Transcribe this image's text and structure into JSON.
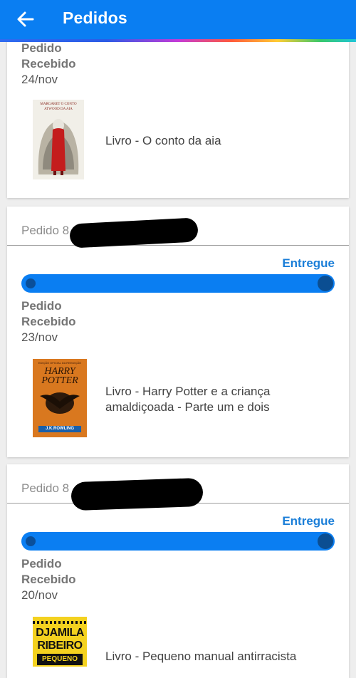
{
  "appbar": {
    "title": "Pedidos",
    "back_icon": "arrow-left-icon"
  },
  "orders": [
    {
      "stage_label_1": "Pedido",
      "stage_label_2": "Recebido",
      "date": "24/nov",
      "item": "Livro - O conto da aia",
      "cover": {
        "title": "MARGARET O CONTO",
        "subtitle": "ATWOOD DA AIA"
      }
    },
    {
      "order_label": "Pedido 8",
      "status": "Entregue",
      "progress": 1.0,
      "stage_label_1": "Pedido",
      "stage_label_2": "Recebido",
      "date": "23/nov",
      "item_line1": "Livro - Harry Potter e a criança",
      "item_line2": "amaldiçoada - Parte um e dois",
      "cover": {
        "top": "EDIÇÃO OFICIAL DA REEDIÇÃO",
        "title1": "HARRY",
        "title2": "POTTER",
        "author": "J.K.ROWLING"
      }
    },
    {
      "order_label": "Pedido 8",
      "status": "Entregue",
      "progress": 1.0,
      "stage_label_1": "Pedido",
      "stage_label_2": "Recebido",
      "date": "20/nov",
      "item": "Livro - Pequeno manual antirracista",
      "cover": {
        "line1": "DJAMILA",
        "line2": "RIBEIRO",
        "line3": "PEQUENO"
      }
    }
  ],
  "colors": {
    "accent": "#0a7ef2",
    "status": "#1a7ed8"
  }
}
